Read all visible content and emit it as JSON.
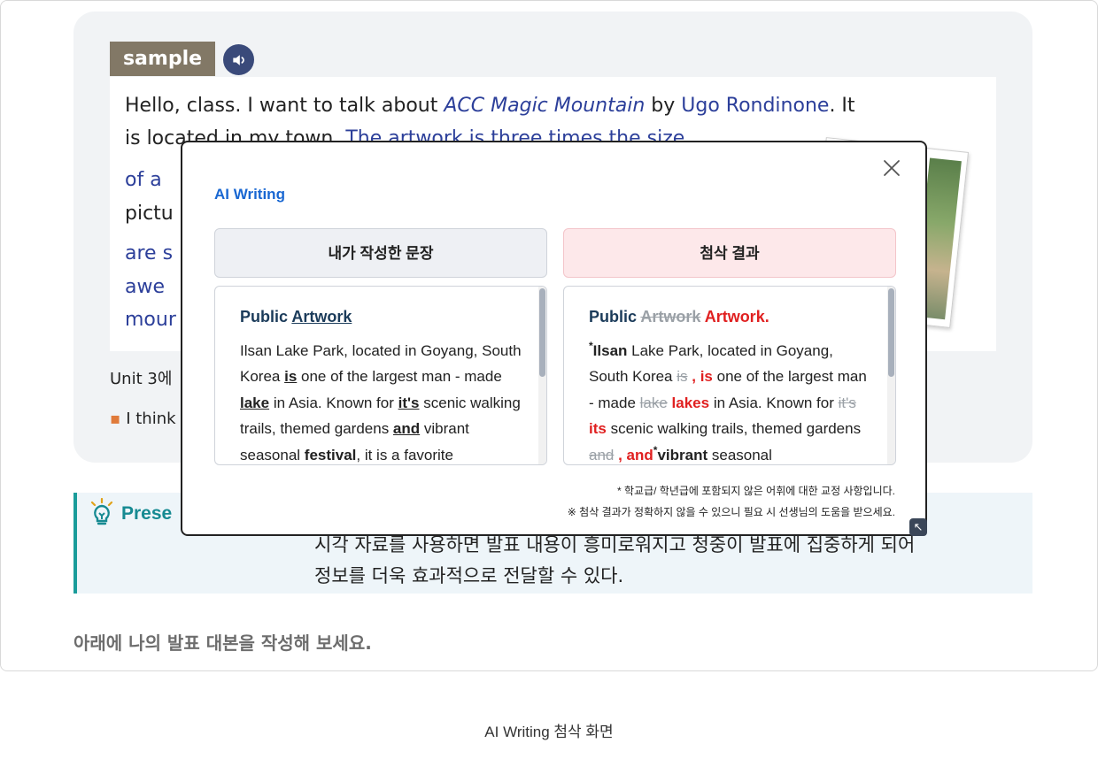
{
  "sample": {
    "tag": "sample",
    "audio_icon": "speaker-icon",
    "lines": {
      "l1a": "Hello, class. I want to talk about ",
      "l1b": "ACC Magic Mountain",
      "l1c": " by ",
      "l1d": "Ugo Rondinone",
      "l1e": ". It",
      "l2a": "is loca",
      "l2b": "ted in my town. ",
      "l2c": "The artwork is three times the size",
      "l3": "of a",
      "l4": "pictu",
      "l5": "are s",
      "l6": "awe",
      "l7": "mour"
    },
    "unit_text": "Unit 3에",
    "bullet_text": "I think"
  },
  "tip": {
    "icon": "lightbulb-icon",
    "title": "Prese",
    "body_line1": "시각 자료를 사용하면 발표 내용이 흥미로워지고 청중이 발표에 집중하게 되어",
    "body_line2": "정보를 더욱 효과적으로 전달할 수 있다."
  },
  "instruction": "아래에 나의 발표 대본을 작성해 보세요.",
  "caption": "AI Writing 첨삭 화면",
  "modal": {
    "title": "AI Writing",
    "close_icon": "close-icon",
    "mine_header": "내가 작성한 문장",
    "result_header": "첨삭 결과",
    "mine": {
      "title_a": "Public ",
      "title_b": "Artwork",
      "t1": "Ilsan Lake Park, located in Goyang, South Korea ",
      "t2": "is",
      "t3": " one of the largest man - made ",
      "t4": "lake",
      "t5": " in Asia. Known for ",
      "t6": "it's",
      "t7": " scenic walking trails, themed gardens ",
      "t8": "and",
      "t9": " vibrant seasonal ",
      "t10": "festival",
      "t11": ", it is a favorite"
    },
    "result": {
      "title_a": "Public ",
      "title_del": "Artwork",
      "title_ins": " Artwork.",
      "asterisk": "*",
      "r1": "Ilsan",
      "r2": " Lake Park, located in Goyang, South Korea ",
      "r3": "is",
      "r4": " , is",
      "r5": " one of the largest man - made ",
      "r6": "lake",
      "r7": " lakes",
      "r8": " in Asia. Known for ",
      "r9": "it's",
      "r10": " its",
      "r11": " scenic walking trails, themed gardens ",
      "r12": "and",
      "r13": " , and",
      "r14": "vibrant",
      "r15": " seasonal"
    },
    "note1": "* 학교급/ 학년급에 포함되지 않은 어휘에 대한 교정 사항입니다.",
    "note2": "※ 첨삭 결과가 정확하지 않을 수 있으니 필요 시 선생님의 도움을 받으세요.",
    "resize_icon": "resize-arrow-icon"
  },
  "colors": {
    "accent_blue": "#1967d2",
    "passage_blue": "#2c3f9a",
    "correction_red": "#e02020",
    "tag_brown": "#827866",
    "tip_teal": "#168a92"
  }
}
